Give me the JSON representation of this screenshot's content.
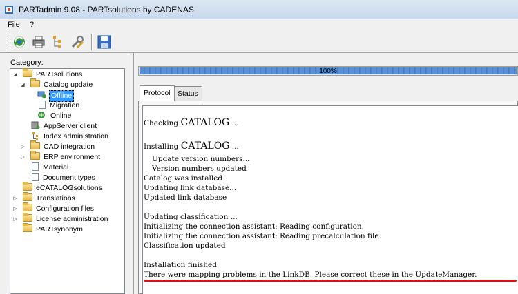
{
  "window": {
    "title": "PARTadmin 9.08 - PARTsolutions by CADENAS"
  },
  "menu": {
    "file": "File",
    "help": "?"
  },
  "toolbar": {
    "icons": [
      "refresh-icon",
      "printer-icon",
      "settings-tree-icon",
      "tools-icon",
      "save-icon"
    ]
  },
  "left": {
    "category_label": "Category:",
    "tree": [
      {
        "label": "PARTsolutions",
        "icon": "folder"
      },
      {
        "label": "Catalog update",
        "icon": "folder"
      },
      {
        "label": "Offline",
        "icon": "offline",
        "selected": true
      },
      {
        "label": "Migration",
        "icon": "document"
      },
      {
        "label": "Online",
        "icon": "online"
      },
      {
        "label": "AppServer client",
        "icon": "appserver"
      },
      {
        "label": "Index administration",
        "icon": "index"
      },
      {
        "label": "CAD integration",
        "icon": "folder"
      },
      {
        "label": "ERP environment",
        "icon": "folder"
      },
      {
        "label": "Material",
        "icon": "document"
      },
      {
        "label": "Document types",
        "icon": "document"
      },
      {
        "label": "eCATALOGsolutions",
        "icon": "folder"
      },
      {
        "label": "Translations",
        "icon": "folder"
      },
      {
        "label": "Configuration files",
        "icon": "folder"
      },
      {
        "label": "License administration",
        "icon": "folder"
      },
      {
        "label": "PARTsynonym",
        "icon": "folder"
      }
    ]
  },
  "progress": {
    "value": 1.0,
    "label": "100%"
  },
  "tabs": [
    "Protocol",
    "Status"
  ],
  "log": [
    "Checking CATALOG ...",
    "Installing CATALOG ...",
    "Update version numbers...",
    "Version numbers updated",
    "Catalog was installed",
    "Updating link database...",
    "Updated link database",
    "Updating classification ...",
    "Initializing the connection assistant: Reading configuration.",
    "Initializing the connection assistant: Reading precalculation file.",
    "Classification updated",
    "Installation finished",
    "There were mapping problems in the LinkDB. Please correct these in the UpdateManager."
  ],
  "colors": {
    "selection": "#3399ff",
    "underline": "#e01010",
    "progress": "#5a8fd4"
  }
}
